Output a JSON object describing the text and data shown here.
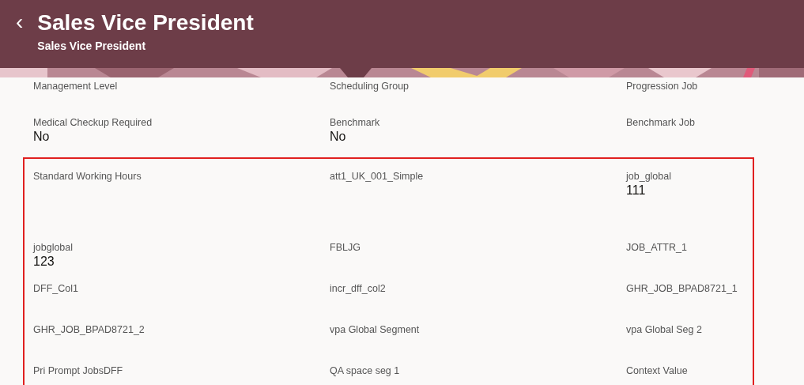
{
  "header": {
    "back_icon": "‹",
    "title": "Sales Vice President",
    "subtitle": "Sales Vice President"
  },
  "sections": [
    {
      "kind": "plain",
      "rows": [
        [
          {
            "label": "Management Level"
          },
          {
            "label": "Scheduling Group"
          },
          {
            "label": "Progression Job"
          }
        ],
        [
          {
            "label": "Medical Checkup Required",
            "value": "No"
          },
          {
            "label": "Benchmark",
            "value": "No"
          },
          {
            "label": "Benchmark Job"
          }
        ]
      ]
    },
    {
      "kind": "highlighted",
      "rows": [
        [
          {
            "label": "Standard Working Hours"
          },
          {
            "label": "att1_UK_001_Simple"
          },
          {
            "label": "job_global",
            "value": "111"
          }
        ],
        [
          {
            "label": "jobglobal",
            "value": "123"
          },
          {
            "label": "FBLJG"
          },
          {
            "label": "JOB_ATTR_1"
          }
        ],
        [
          {
            "label": "DFF_Col1"
          },
          {
            "label": "incr_dff_col2"
          },
          {
            "label": "GHR_JOB_BPAD8721_1"
          }
        ],
        [
          {
            "label": "GHR_JOB_BPAD8721_2"
          },
          {
            "label": "vpa Global Segment"
          },
          {
            "label": "vpa Global Seg 2"
          }
        ],
        [
          {
            "label": "Pri Prompt JobsDFF"
          },
          {
            "label": "QA space seg 1"
          },
          {
            "label": "Context Value"
          }
        ]
      ]
    }
  ]
}
